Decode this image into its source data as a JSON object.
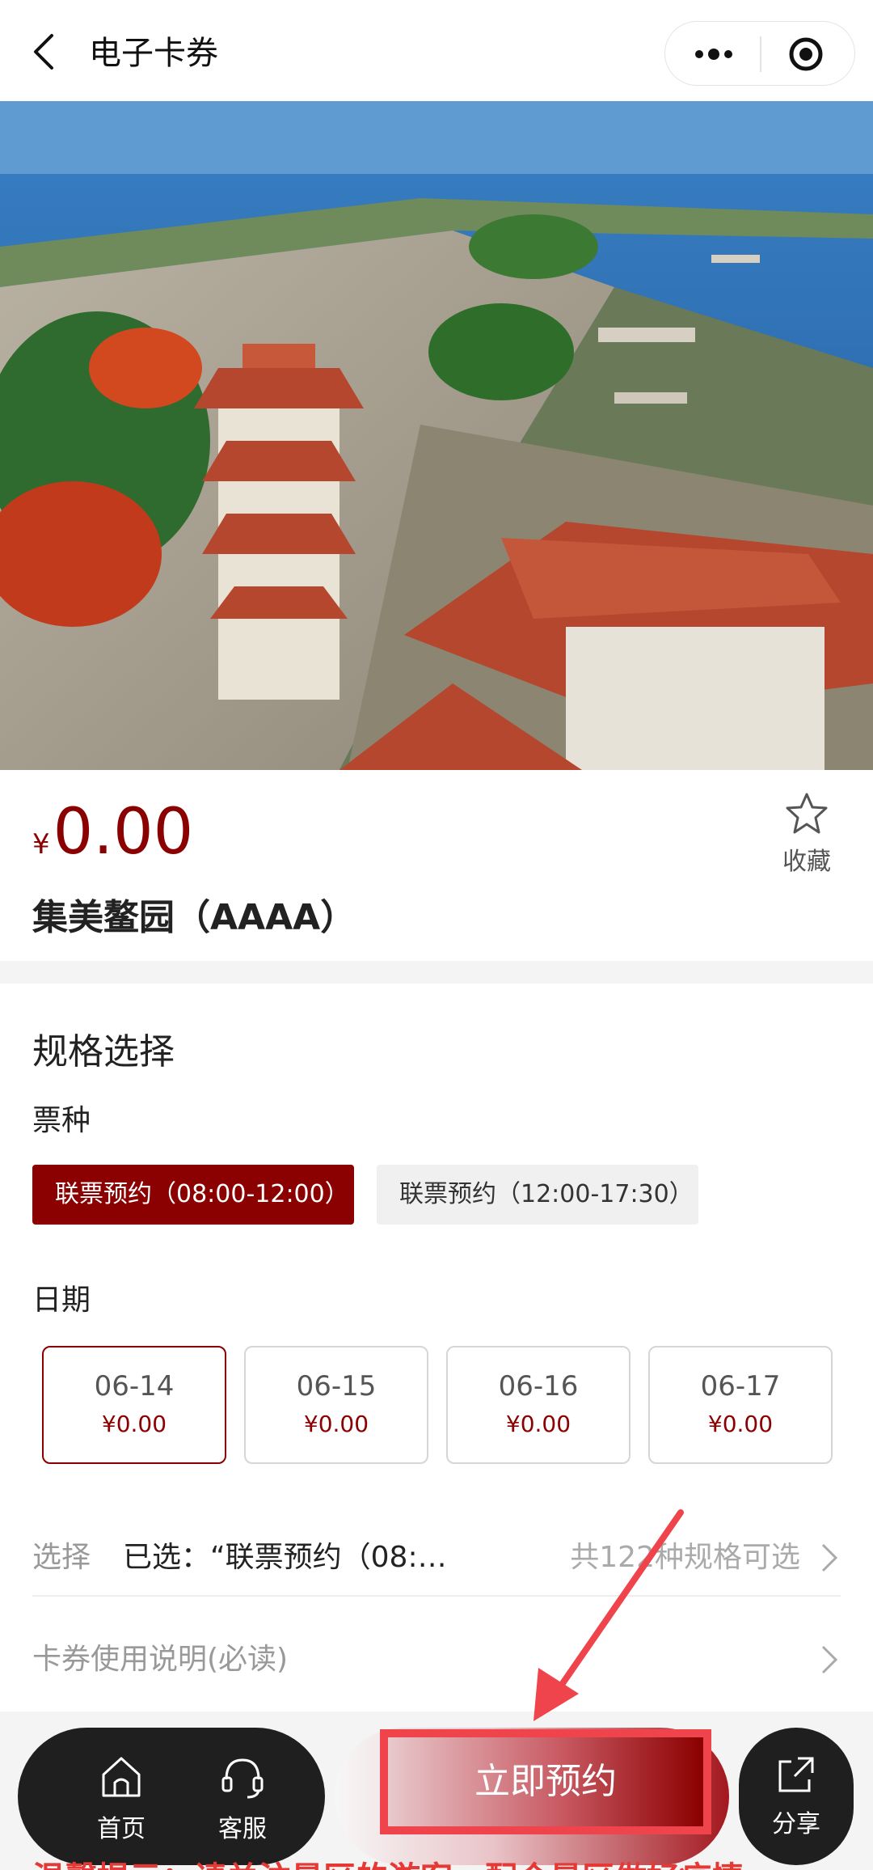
{
  "header": {
    "title": "电子卡券"
  },
  "product": {
    "currency": "¥",
    "price": "0.00",
    "name": "集美鳌园（AAAA）",
    "favorite_label": "收藏"
  },
  "spec": {
    "title": "规格选择",
    "ticket_label": "票种",
    "tickets": [
      {
        "label": "联票预约（08:00-12:00）",
        "selected": true
      },
      {
        "label": "联票预约（12:00-17:30）",
        "selected": false
      }
    ],
    "date_label": "日期",
    "dates": [
      {
        "date": "06-14",
        "price": "¥0.00",
        "selected": true
      },
      {
        "date": "06-15",
        "price": "¥0.00",
        "selected": false
      },
      {
        "date": "06-16",
        "price": "¥0.00",
        "selected": false
      },
      {
        "date": "06-17",
        "price": "¥0.00",
        "selected": false
      }
    ],
    "select_key": "选择",
    "select_value": "已选：“联票预约（08:…",
    "select_count": "共122种规格可选",
    "rules_label": "卡券使用说明(必读)"
  },
  "bottom": {
    "home_label": "首页",
    "service_label": "客服",
    "book_label": "立即预约",
    "share_label": "分享"
  },
  "tip": "温馨提示：请关注景区的游客，配合景区做好疫情",
  "colors": {
    "accent": "#8b0000",
    "annotation": "#f0444c"
  }
}
